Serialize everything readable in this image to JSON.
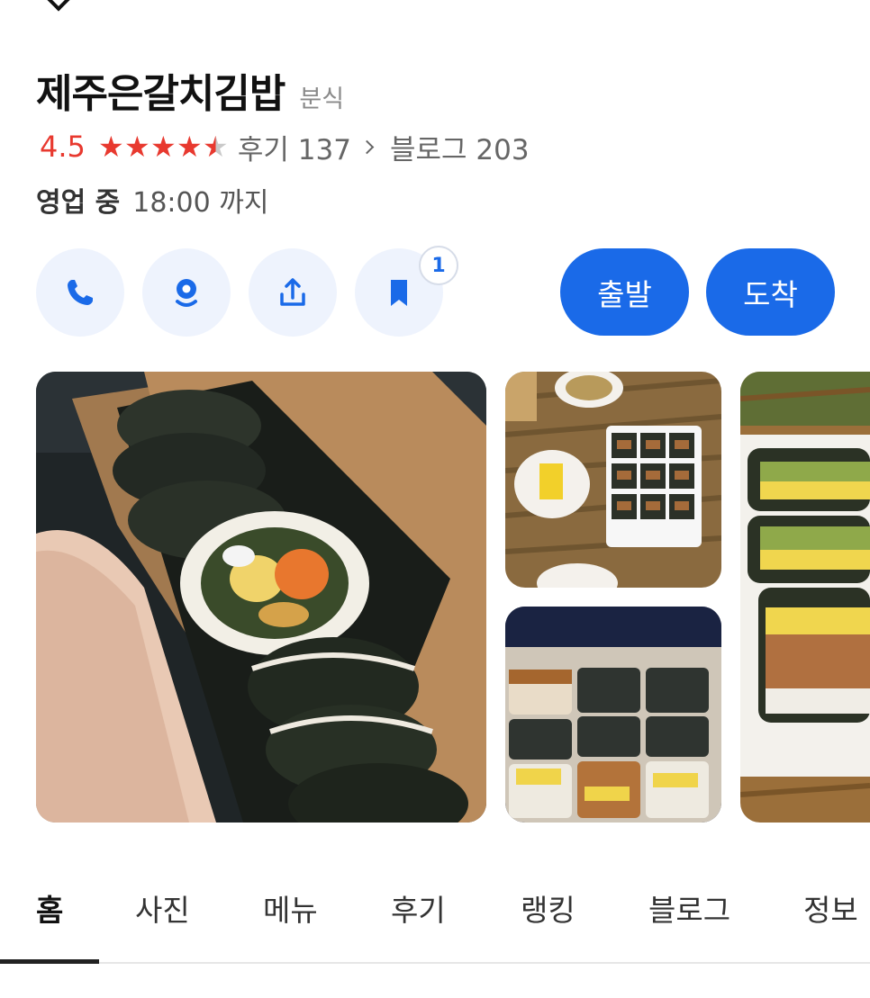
{
  "place": {
    "name": "제주은갈치김밥",
    "category": "분식",
    "rating": "4.5",
    "stars": [
      "full",
      "full",
      "full",
      "full",
      "half"
    ],
    "review_label": "후기 137",
    "blog_label": "블로그 203",
    "status": "영업 중",
    "hours": "18:00 까지"
  },
  "actions": {
    "save_count": "1",
    "depart_label": "출발",
    "arrive_label": "도착",
    "icons": [
      "phone-icon",
      "navigation-pin-icon",
      "share-icon",
      "bookmark-icon"
    ]
  },
  "tabs": [
    "홈",
    "사진",
    "메뉴",
    "후기",
    "랭킹",
    "블로그",
    "정보"
  ],
  "active_tab": "홈",
  "colors": {
    "accent": "#1a6ae8",
    "rating": "#e8392f",
    "action_bg": "#eef3fd"
  }
}
